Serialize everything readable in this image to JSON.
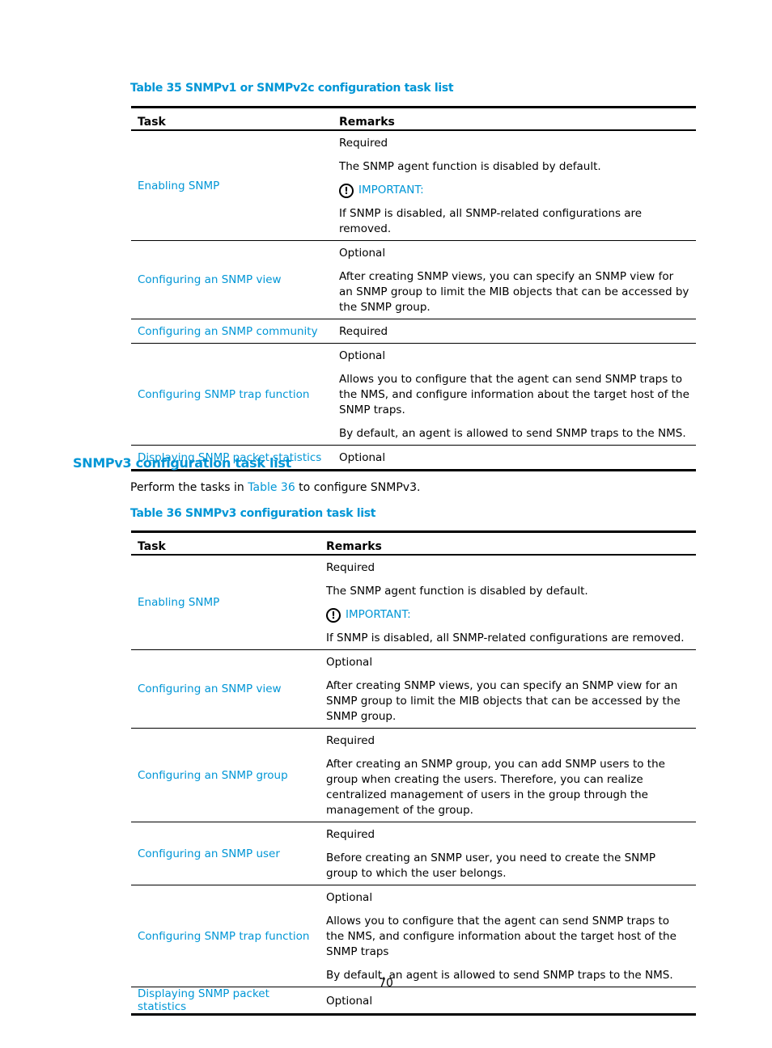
{
  "table35": {
    "caption": "Table 35 SNMPv1 or SNMPv2c configuration task list",
    "headers": {
      "task": "Task",
      "remarks": "Remarks"
    },
    "rows": [
      {
        "task": "Enabling SNMP",
        "remarks": [
          "Required",
          "The SNMP agent function is disabled by default."
        ],
        "important_label": "IMPORTANT:",
        "important_text": "If SNMP is disabled, all SNMP-related configurations are removed."
      },
      {
        "task": "Configuring an SNMP view",
        "remarks": [
          "Optional",
          "After creating SNMP views, you can specify an SNMP view for an SNMP group to limit the MIB objects that can be accessed by the SNMP group."
        ]
      },
      {
        "task": "Configuring an SNMP community",
        "remarks": [
          "Required"
        ]
      },
      {
        "task": "Configuring SNMP trap function",
        "remarks": [
          "Optional",
          "Allows you to configure that the agent can send SNMP traps to the NMS, and configure information about the target host of the SNMP traps.",
          "By default, an agent is allowed to send SNMP traps to the NMS."
        ]
      },
      {
        "task": "Displaying SNMP packet statistics",
        "remarks": [
          "Optional"
        ]
      }
    ]
  },
  "section": {
    "heading": "SNMPv3 configuration task list",
    "para_before": "Perform the tasks in ",
    "para_link": "Table 36",
    "para_after": " to configure SNMPv3."
  },
  "table36": {
    "caption": "Table 36 SNMPv3 configuration task list",
    "headers": {
      "task": "Task",
      "remarks": "Remarks"
    },
    "rows": [
      {
        "task": "Enabling SNMP",
        "remarks": [
          "Required",
          "The SNMP agent function is disabled by default."
        ],
        "important_label": "IMPORTANT:",
        "important_text": "If SNMP is disabled, all SNMP-related configurations are removed."
      },
      {
        "task": "Configuring an SNMP view",
        "remarks": [
          "Optional",
          "After creating SNMP views, you can specify an SNMP view for an SNMP group to limit the MIB objects that can be accessed by the SNMP group."
        ]
      },
      {
        "task": "Configuring an SNMP group",
        "remarks": [
          "Required",
          "After creating an SNMP group, you can add SNMP users to the group when creating the users. Therefore, you can realize centralized management of users in the group through the management of the group."
        ]
      },
      {
        "task": "Configuring an SNMP user",
        "remarks": [
          "Required",
          "Before creating an SNMP user, you need to create the SNMP group to which the user belongs."
        ]
      },
      {
        "task": "Configuring SNMP trap function",
        "remarks": [
          "Optional",
          "Allows you to configure that the agent can send SNMP traps to the NMS, and configure information about the target host of the SNMP traps",
          "By default, an agent is allowed to send SNMP traps to the NMS."
        ]
      },
      {
        "task": "Displaying SNMP packet statistics",
        "remarks": [
          "Optional"
        ]
      }
    ]
  },
  "page_number": "70",
  "colors": {
    "accent": "#0096d6",
    "text": "#000000"
  }
}
